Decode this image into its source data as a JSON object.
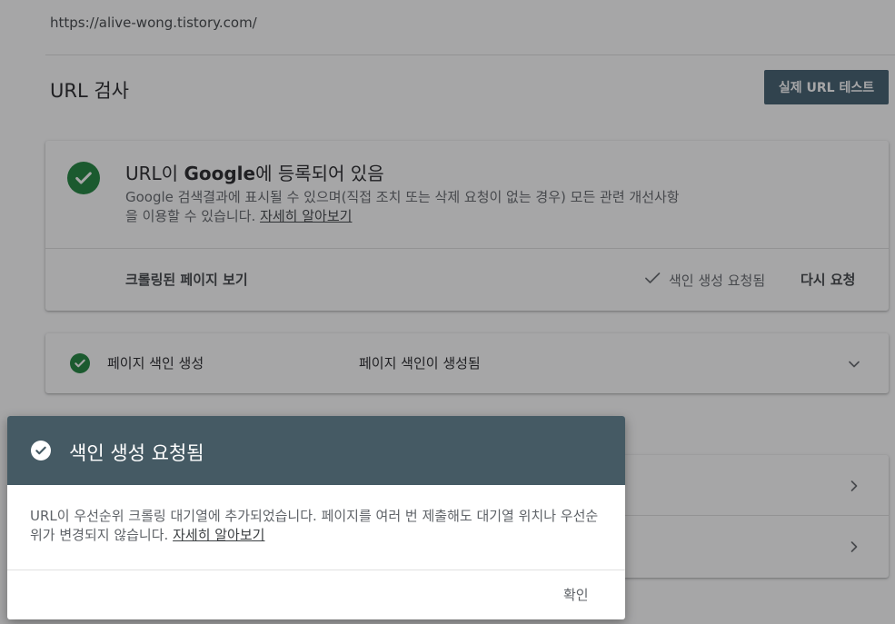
{
  "page": {
    "url": "https://alive-wong.tistory.com/",
    "title": "URL 검사",
    "live_test_button": "실제 URL 테스트"
  },
  "status_card": {
    "title_prefix": "URL이 ",
    "title_brand": "Google",
    "title_suffix": "에 등록되어 있음",
    "description": "Google 검색결과에 표시될 수 있으며(직접 조치 또는 삭제 요청이 없는 경우) 모든 관련 개선사항을 이용할 수 있습니다.",
    "learn_more": "자세히 알아보기",
    "view_crawled_page": "크롤링된 페이지 보기",
    "indexing_requested": "색인 생성 요청됨",
    "request_again": "다시 요청"
  },
  "indexing_card": {
    "label": "페이지 색인 생성",
    "value": "페이지 색인이 생성됨"
  },
  "dialog": {
    "title": "색인 생성 요청됨",
    "body": "URL이 우선순위 크롤링 대기열에 추가되었습니다. 페이지를 여러 번 제출해도 대기열 위치나 우선순위가 변경되지 않습니다.",
    "learn_more": "자세히 알아보기",
    "confirm": "확인"
  },
  "colors": {
    "success_green": "#188038",
    "dialog_header": "#455a64",
    "button_bg": "#3d5a6c"
  },
  "icons": {
    "status": "check-circle-icon",
    "requested": "checkmark-icon",
    "expand": "chevron-down-icon",
    "row_nav": "chevron-right-icon"
  }
}
